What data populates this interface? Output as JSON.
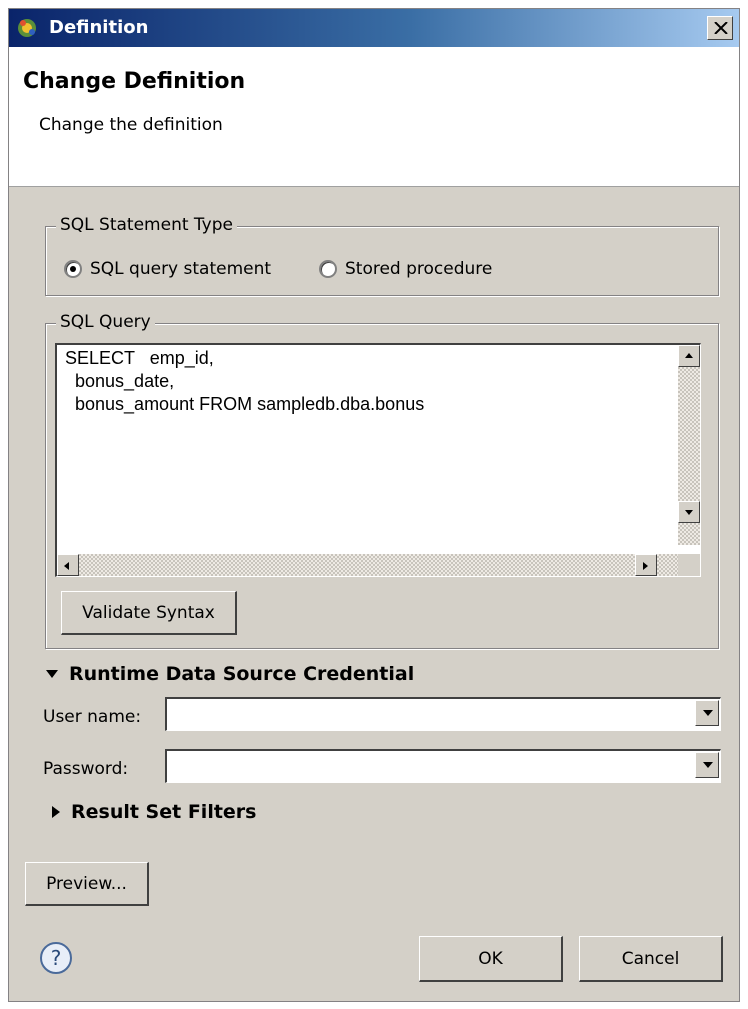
{
  "window": {
    "title": "Definition",
    "close_glyph": "✕"
  },
  "header": {
    "title": "Change Definition",
    "description": "Change the definition"
  },
  "statement_type": {
    "legend": "SQL Statement Type",
    "options": [
      {
        "label": "SQL query statement",
        "selected": true
      },
      {
        "label": "Stored procedure",
        "selected": false
      }
    ]
  },
  "sql_query": {
    "legend": "SQL Query",
    "text": "SELECT   emp_id,\n  bonus_date,\n  bonus_amount FROM sampledb.dba.bonus",
    "validate_label": "Validate Syntax"
  },
  "credentials": {
    "title": "Runtime Data Source Credential",
    "expanded": true,
    "user_label": "User name:",
    "user_value": "",
    "password_label": "Password:",
    "password_value": ""
  },
  "filters": {
    "title": "Result Set Filters",
    "expanded": false
  },
  "buttons": {
    "preview": "Preview...",
    "ok": "OK",
    "cancel": "Cancel"
  },
  "icons": {
    "app": "gear-app-icon",
    "help": "help-icon",
    "colors": {
      "title_start": "#0a246a",
      "title_end": "#a6caf0",
      "dialog_bg": "#d4d0c8"
    }
  }
}
